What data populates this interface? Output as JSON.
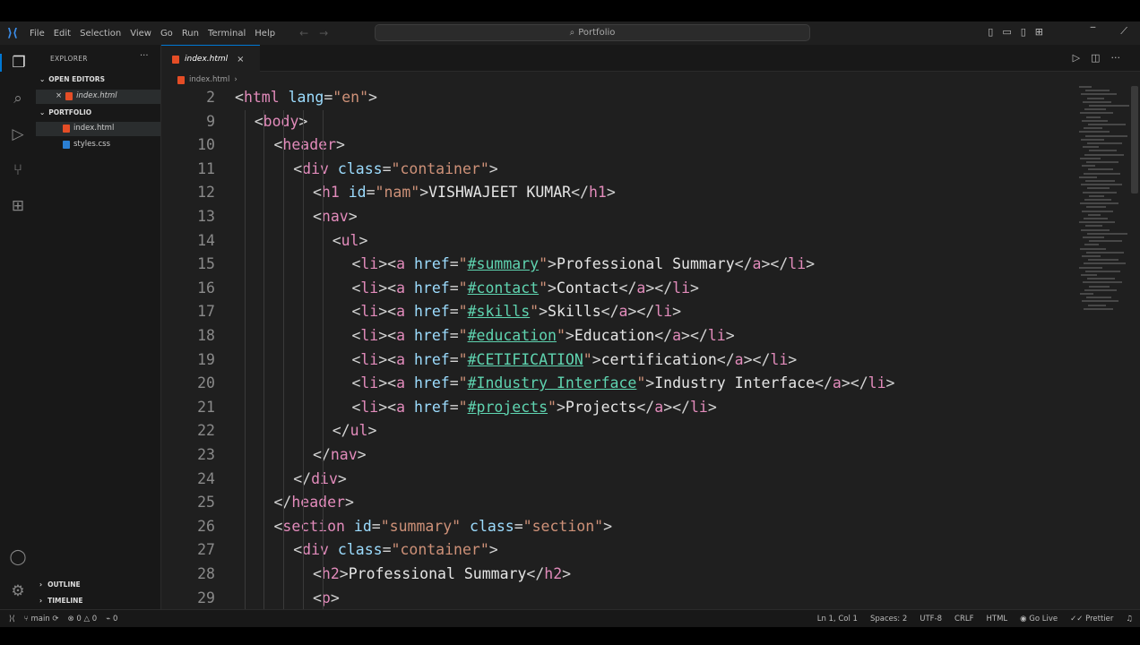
{
  "titlebar": {
    "menu": [
      "File",
      "Edit",
      "Selection",
      "View",
      "Go",
      "Run",
      "Terminal",
      "Help"
    ],
    "search_text": "Portfolio"
  },
  "sidebar": {
    "title": "EXPLORER",
    "open_editors_label": "OPEN EDITORS",
    "open_file": "index.html",
    "folder_label": "PORTFOLIO",
    "files": [
      "index.html",
      "styles.css"
    ],
    "outline_label": "OUTLINE",
    "timeline_label": "TIMELINE"
  },
  "editor": {
    "tab_label": "index.html",
    "breadcrumb": "index.html",
    "lines": [
      {
        "n": "2",
        "indent": 0,
        "parts": [
          [
            "tg",
            "<"
          ],
          [
            "tn",
            "html"
          ],
          [
            "at",
            " lang"
          ],
          [
            "tg",
            "="
          ],
          [
            "st",
            "\"en\""
          ],
          [
            "tg",
            ">"
          ]
        ]
      },
      {
        "n": "9",
        "indent": 1,
        "parts": [
          [
            "tg",
            "<"
          ],
          [
            "tn",
            "body"
          ],
          [
            "tg",
            ">"
          ]
        ]
      },
      {
        "n": "10",
        "indent": 2,
        "parts": [
          [
            "tg",
            "<"
          ],
          [
            "tn",
            "header"
          ],
          [
            "tg",
            ">"
          ]
        ]
      },
      {
        "n": "11",
        "indent": 3,
        "parts": [
          [
            "tg",
            "<"
          ],
          [
            "tn",
            "div"
          ],
          [
            "at",
            " class"
          ],
          [
            "tg",
            "="
          ],
          [
            "st",
            "\"container\""
          ],
          [
            "tg",
            ">"
          ]
        ]
      },
      {
        "n": "12",
        "indent": 4,
        "parts": [
          [
            "tg",
            "<"
          ],
          [
            "tn",
            "h1"
          ],
          [
            "at",
            " id"
          ],
          [
            "tg",
            "="
          ],
          [
            "st",
            "\"nam\""
          ],
          [
            "tg",
            ">"
          ],
          [
            "tx",
            "VISHWAJEET KUMAR"
          ],
          [
            "tg",
            "</"
          ],
          [
            "tn",
            "h1"
          ],
          [
            "tg",
            ">"
          ]
        ]
      },
      {
        "n": "13",
        "indent": 4,
        "parts": [
          [
            "tg",
            "<"
          ],
          [
            "tn",
            "nav"
          ],
          [
            "tg",
            ">"
          ]
        ]
      },
      {
        "n": "14",
        "indent": 5,
        "parts": [
          [
            "tg",
            "<"
          ],
          [
            "tn",
            "ul"
          ],
          [
            "tg",
            ">"
          ]
        ]
      },
      {
        "n": "15",
        "indent": 6,
        "parts": [
          [
            "tg",
            "<"
          ],
          [
            "tn",
            "li"
          ],
          [
            "tg",
            "><"
          ],
          [
            "tn",
            "a"
          ],
          [
            "at",
            " href"
          ],
          [
            "tg",
            "="
          ],
          [
            "st",
            "\""
          ],
          [
            "lk",
            "#summary"
          ],
          [
            "st",
            "\""
          ],
          [
            "tg",
            ">"
          ],
          [
            "tx",
            "Professional Summary"
          ],
          [
            "tg",
            "</"
          ],
          [
            "tn",
            "a"
          ],
          [
            "tg",
            "></"
          ],
          [
            "tn",
            "li"
          ],
          [
            "tg",
            ">"
          ]
        ]
      },
      {
        "n": "16",
        "indent": 6,
        "parts": [
          [
            "tg",
            "<"
          ],
          [
            "tn",
            "li"
          ],
          [
            "tg",
            "><"
          ],
          [
            "tn",
            "a"
          ],
          [
            "at",
            " href"
          ],
          [
            "tg",
            "="
          ],
          [
            "st",
            "\""
          ],
          [
            "lk",
            "#contact"
          ],
          [
            "st",
            "\""
          ],
          [
            "tg",
            ">"
          ],
          [
            "tx",
            "Contact"
          ],
          [
            "tg",
            "</"
          ],
          [
            "tn",
            "a"
          ],
          [
            "tg",
            "></"
          ],
          [
            "tn",
            "li"
          ],
          [
            "tg",
            ">"
          ]
        ]
      },
      {
        "n": "17",
        "indent": 6,
        "parts": [
          [
            "tg",
            "<"
          ],
          [
            "tn",
            "li"
          ],
          [
            "tg",
            "><"
          ],
          [
            "tn",
            "a"
          ],
          [
            "at",
            " href"
          ],
          [
            "tg",
            "="
          ],
          [
            "st",
            "\""
          ],
          [
            "lk",
            "#skills"
          ],
          [
            "st",
            "\""
          ],
          [
            "tg",
            ">"
          ],
          [
            "tx",
            "Skills"
          ],
          [
            "tg",
            "</"
          ],
          [
            "tn",
            "a"
          ],
          [
            "tg",
            "></"
          ],
          [
            "tn",
            "li"
          ],
          [
            "tg",
            ">"
          ]
        ]
      },
      {
        "n": "18",
        "indent": 6,
        "parts": [
          [
            "tg",
            "<"
          ],
          [
            "tn",
            "li"
          ],
          [
            "tg",
            "><"
          ],
          [
            "tn",
            "a"
          ],
          [
            "at",
            " href"
          ],
          [
            "tg",
            "="
          ],
          [
            "st",
            "\""
          ],
          [
            "lk",
            "#education"
          ],
          [
            "st",
            "\""
          ],
          [
            "tg",
            ">"
          ],
          [
            "tx",
            "Education"
          ],
          [
            "tg",
            "</"
          ],
          [
            "tn",
            "a"
          ],
          [
            "tg",
            "></"
          ],
          [
            "tn",
            "li"
          ],
          [
            "tg",
            ">"
          ]
        ]
      },
      {
        "n": "19",
        "indent": 6,
        "parts": [
          [
            "tg",
            "<"
          ],
          [
            "tn",
            "li"
          ],
          [
            "tg",
            "><"
          ],
          [
            "tn",
            "a"
          ],
          [
            "at",
            " href"
          ],
          [
            "tg",
            "="
          ],
          [
            "st",
            "\""
          ],
          [
            "lk",
            "#CETIFICATION"
          ],
          [
            "st",
            "\""
          ],
          [
            "tg",
            ">"
          ],
          [
            "tx",
            "certification"
          ],
          [
            "tg",
            "</"
          ],
          [
            "tn",
            "a"
          ],
          [
            "tg",
            "></"
          ],
          [
            "tn",
            "li"
          ],
          [
            "tg",
            ">"
          ]
        ]
      },
      {
        "n": "20",
        "indent": 6,
        "parts": [
          [
            "tg",
            "<"
          ],
          [
            "tn",
            "li"
          ],
          [
            "tg",
            "><"
          ],
          [
            "tn",
            "a"
          ],
          [
            "at",
            " href"
          ],
          [
            "tg",
            "="
          ],
          [
            "st",
            "\""
          ],
          [
            "lk",
            "#Industry Interface"
          ],
          [
            "st",
            "\""
          ],
          [
            "tg",
            ">"
          ],
          [
            "tx",
            "Industry Interface"
          ],
          [
            "tg",
            "</"
          ],
          [
            "tn",
            "a"
          ],
          [
            "tg",
            "></"
          ],
          [
            "tn",
            "li"
          ],
          [
            "tg",
            ">"
          ]
        ]
      },
      {
        "n": "21",
        "indent": 6,
        "parts": [
          [
            "tg",
            "<"
          ],
          [
            "tn",
            "li"
          ],
          [
            "tg",
            "><"
          ],
          [
            "tn",
            "a"
          ],
          [
            "at",
            " href"
          ],
          [
            "tg",
            "="
          ],
          [
            "st",
            "\""
          ],
          [
            "lk",
            "#projects"
          ],
          [
            "st",
            "\""
          ],
          [
            "tg",
            ">"
          ],
          [
            "tx",
            "Projects"
          ],
          [
            "tg",
            "</"
          ],
          [
            "tn",
            "a"
          ],
          [
            "tg",
            "></"
          ],
          [
            "tn",
            "li"
          ],
          [
            "tg",
            ">"
          ]
        ]
      },
      {
        "n": "22",
        "indent": 5,
        "parts": [
          [
            "tg",
            "</"
          ],
          [
            "tn",
            "ul"
          ],
          [
            "tg",
            ">"
          ]
        ]
      },
      {
        "n": "23",
        "indent": 4,
        "parts": [
          [
            "tg",
            "</"
          ],
          [
            "tn",
            "nav"
          ],
          [
            "tg",
            ">"
          ]
        ]
      },
      {
        "n": "24",
        "indent": 3,
        "parts": [
          [
            "tg",
            "</"
          ],
          [
            "tn",
            "div"
          ],
          [
            "tg",
            ">"
          ]
        ]
      },
      {
        "n": "25",
        "indent": 2,
        "parts": [
          [
            "tg",
            "</"
          ],
          [
            "tn",
            "header"
          ],
          [
            "tg",
            ">"
          ]
        ]
      },
      {
        "n": "26",
        "indent": 2,
        "parts": [
          [
            "tg",
            "<"
          ],
          [
            "tn",
            "section"
          ],
          [
            "at",
            " id"
          ],
          [
            "tg",
            "="
          ],
          [
            "st",
            "\"summary\""
          ],
          [
            "at",
            " class"
          ],
          [
            "tg",
            "="
          ],
          [
            "st",
            "\"section\""
          ],
          [
            "tg",
            ">"
          ]
        ]
      },
      {
        "n": "27",
        "indent": 3,
        "parts": [
          [
            "tg",
            "<"
          ],
          [
            "tn",
            "div"
          ],
          [
            "at",
            " class"
          ],
          [
            "tg",
            "="
          ],
          [
            "st",
            "\"container\""
          ],
          [
            "tg",
            ">"
          ]
        ]
      },
      {
        "n": "28",
        "indent": 4,
        "parts": [
          [
            "tg",
            "<"
          ],
          [
            "tn",
            "h2"
          ],
          [
            "tg",
            ">"
          ],
          [
            "tx",
            "Professional Summary"
          ],
          [
            "tg",
            "</"
          ],
          [
            "tn",
            "h2"
          ],
          [
            "tg",
            ">"
          ]
        ]
      },
      {
        "n": "29",
        "indent": 4,
        "parts": [
          [
            "tg",
            "<"
          ],
          [
            "tn",
            "p"
          ],
          [
            "tg",
            ">"
          ]
        ]
      }
    ]
  },
  "statusbar": {
    "branch": "main",
    "errors": "0",
    "warnings": "0",
    "ports": "0",
    "position": "Ln 1, Col 1",
    "spaces": "Spaces: 2",
    "encoding": "UTF-8",
    "eol": "CRLF",
    "language": "HTML",
    "golive": "Go Live",
    "prettier": "Prettier"
  },
  "colors": {
    "accent": "#0078d4",
    "tag_name": "#e28bbb",
    "attribute": "#9cdcfe",
    "string": "#ce9178",
    "link": "#5fd4b0"
  }
}
